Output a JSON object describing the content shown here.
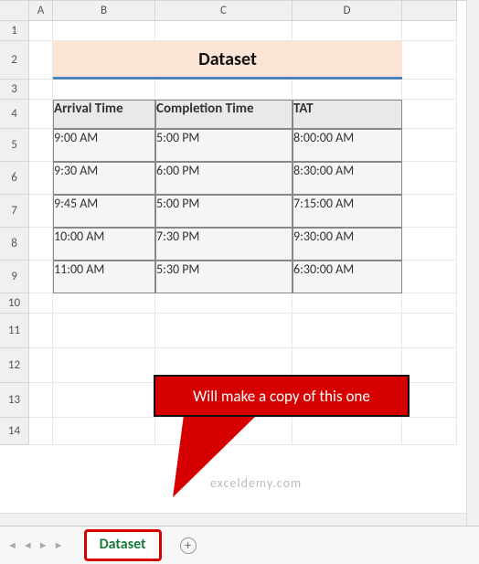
{
  "columns": [
    "A",
    "B",
    "C",
    "D"
  ],
  "rows": [
    "1",
    "2",
    "3",
    "4",
    "5",
    "6",
    "7",
    "8",
    "9",
    "10",
    "11",
    "12",
    "13",
    "14"
  ],
  "title": "Dataset",
  "headers": {
    "arrival": "Arrival Time",
    "completion": "Completion Time",
    "tat": "TAT"
  },
  "data": [
    {
      "arrival": "9:00 AM",
      "completion": "5:00 PM",
      "tat": "8:00:00 AM"
    },
    {
      "arrival": "9:30 AM",
      "completion": "6:00 PM",
      "tat": "8:30:00 AM"
    },
    {
      "arrival": "9:45 AM",
      "completion": "5:00 PM",
      "tat": "7:15:00 AM"
    },
    {
      "arrival": "10:00 AM",
      "completion": "7:30 PM",
      "tat": "9:30:00 AM"
    },
    {
      "arrival": "11:00 AM",
      "completion": "5:30 PM",
      "tat": "6:30:00 AM"
    }
  ],
  "callout_text": "Will make a copy of this one",
  "watermark": "exceldemy.com",
  "tab_name": "Dataset",
  "nav": {
    "prev_all": "◄",
    "prev": "◄",
    "next": "►",
    "next_all": "►"
  },
  "add_icon": "+"
}
